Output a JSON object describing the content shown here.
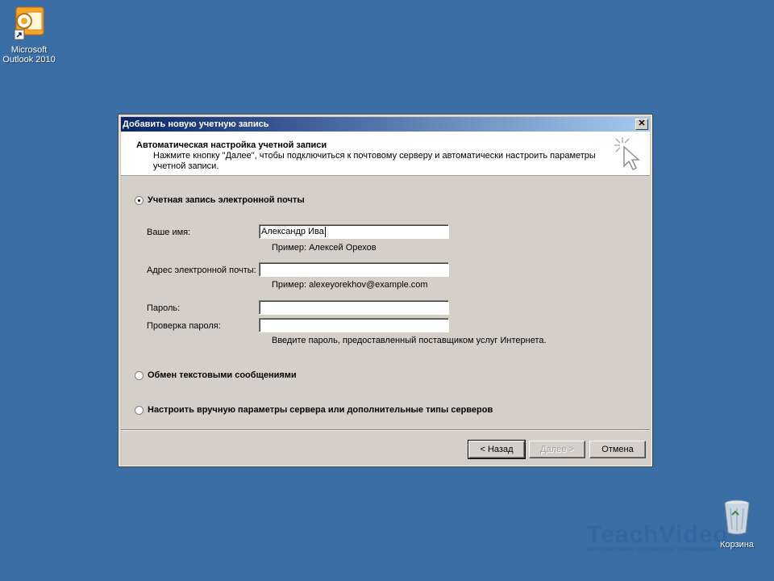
{
  "desktop": {
    "outlook_label_line1": "Microsoft",
    "outlook_label_line2": "Outlook 2010",
    "recycle_bin_label": "Корзина",
    "watermark_big": "TeachVideo",
    "watermark_small": "Интерактивное обучающее телевидение"
  },
  "dialog": {
    "title": "Добавить новую учетную запись",
    "close_glyph": "✕",
    "header_title": "Автоматическая настройка учетной записи",
    "header_desc": "Нажмите кнопку \"Далее\", чтобы подключиться к почтовому серверу и автоматически настроить параметры учетной записи.",
    "options": {
      "email": "Учетная запись электронной почты",
      "sms": "Обмен текстовыми сообщениями",
      "manual": "Настроить вручную параметры сервера или дополнительные типы серверов"
    },
    "fields": {
      "name_label": "Ваше имя:",
      "name_value": "Александр Ива",
      "name_hint": "Пример: Алексей Орехов",
      "email_label": "Адрес электронной почты:",
      "email_value": "",
      "email_hint": "Пример: alexeyorekhov@example.com",
      "password_label": "Пароль:",
      "password_value": "",
      "confirm_label": "Проверка пароля:",
      "confirm_value": "",
      "password_hint": "Введите пароль, предоставленный поставщиком услуг Интернета."
    },
    "buttons": {
      "back": "< Назад",
      "next": "Далее >",
      "cancel": "Отмена"
    }
  },
  "colors": {
    "desktop": "#3b6ea5",
    "titlebar_start": "#0a246a",
    "titlebar_end": "#a6caf0",
    "dialog_face": "#d4d0c8"
  }
}
